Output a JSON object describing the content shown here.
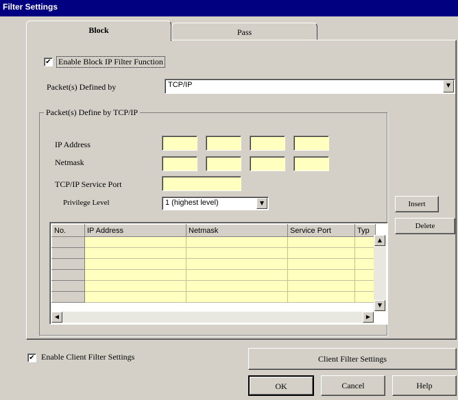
{
  "window": {
    "title": "Filter Settings"
  },
  "tabs": [
    {
      "label": "Block",
      "active": true
    },
    {
      "label": "Pass",
      "active": false
    }
  ],
  "block": {
    "enable_checked": true,
    "enable_label": "Enable Block IP Filter Function",
    "packets_defined_by_label": "Packet(s) Defined by",
    "packets_defined_by_value": "TCP/IP",
    "group_label": "Packet(s) Define by TCP/IP",
    "ip_address_label": "IP Address",
    "ip_address": [
      "",
      "",
      "",
      ""
    ],
    "netmask_label": "Netmask",
    "netmask": [
      "",
      "",
      "",
      ""
    ],
    "service_port_label": "TCP/IP Service Port",
    "service_port": "",
    "privilege_label": "Privilege Level",
    "privilege_value": "1 (highest level)",
    "insert_label": "Insert",
    "delete_label": "Delete",
    "table": {
      "columns": [
        "No.",
        "IP Address",
        "Netmask",
        "Service Port",
        "Typ"
      ],
      "rows": [
        [
          "",
          "",
          "",
          "",
          ""
        ],
        [
          "",
          "",
          "",
          "",
          ""
        ],
        [
          "",
          "",
          "",
          "",
          ""
        ],
        [
          "",
          "",
          "",
          "",
          ""
        ],
        [
          "",
          "",
          "",
          "",
          ""
        ],
        [
          "",
          "",
          "",
          "",
          ""
        ]
      ]
    }
  },
  "footer": {
    "client_filter_checked": true,
    "client_filter_label": "Enable Client Filter Settings",
    "client_filter_button": "Client Filter Settings",
    "ok": "OK",
    "cancel": "Cancel",
    "help": "Help"
  },
  "icons": {
    "check": "checkmark",
    "dropdown": "triangle-down",
    "scroll_up": "triangle-up",
    "scroll_down": "triangle-down",
    "scroll_left": "triangle-left",
    "scroll_right": "triangle-right"
  }
}
